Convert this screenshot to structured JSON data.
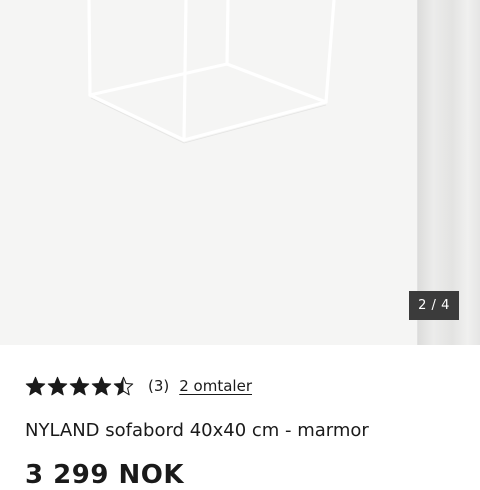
{
  "gallery": {
    "image_alt": "NYLAND sofabord",
    "counter": "2 / 4"
  },
  "product": {
    "rating": {
      "value": 4.5,
      "max": 5,
      "count_text": "(3)",
      "reviews_link": "2 omtaler"
    },
    "title": "NYLAND sofabord 40x40 cm - marmor",
    "price": "3 299 NOK"
  },
  "colors": {
    "star": "#1a1a1a",
    "counter_bg": "#3b3b3b",
    "image_bg": "#f5f5f4"
  }
}
